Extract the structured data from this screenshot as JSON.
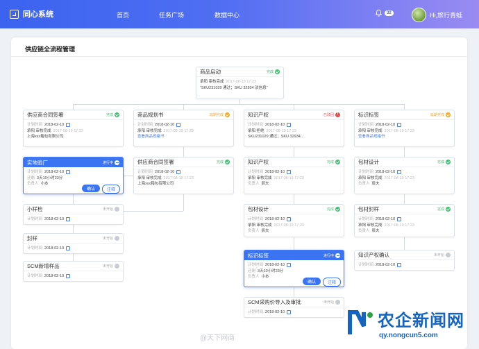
{
  "header": {
    "brand": "同心系统",
    "nav": [
      "首页",
      "任务广场",
      "数据中心"
    ],
    "notif_count": "32",
    "user": "Hi,旅行青蛙"
  },
  "panel": {
    "title": "供应链全流程管理"
  },
  "labels": {
    "plan": "计划时间",
    "owner": "负责人",
    "confirm": "确认",
    "note": "注释",
    "countdown": "还剩"
  },
  "cards": [
    {
      "id": "start",
      "title": "商品启动",
      "status": "完成",
      "type": "g",
      "rows": [
        {
          "a": "承阳",
          "b": "审核完成",
          "c": "2017-08-19 17:23"
        },
        {
          "t": "“SKU231029 通过；SKU 32934 驳信息”"
        }
      ]
    },
    {
      "id": "c1",
      "title": "供应商合同签署",
      "status": "完成",
      "type": "g",
      "rows": [
        {
          "plan": "2018-02-10"
        },
        {
          "a": "承阳",
          "b": "审核完成",
          "c": "2017-08-19 17:23"
        },
        {
          "t": "上海xxx箱包有限公司"
        }
      ]
    },
    {
      "id": "c2",
      "title": "商品规划书",
      "status": "延期完成",
      "type": "o",
      "rows": [
        {
          "plan": "2018-02-10"
        },
        {
          "a": "承阳",
          "b": "审核完成",
          "c": "2017-08-19 17:23"
        },
        {
          "link": "查看商品规格书"
        }
      ]
    },
    {
      "id": "c3",
      "title": "知识产权",
      "status": "已驳回",
      "type": "r",
      "rows": [
        {
          "plan": "2018-02-10"
        },
        {
          "a": "承阳",
          "b": "拒绝",
          "c": "2017-08-19 17:23"
        },
        {
          "t": "SKU231029 通过；SKU 32934..."
        }
      ]
    },
    {
      "id": "c4",
      "title": "标识标签",
      "status": "延期完成",
      "type": "o",
      "rows": [
        {
          "plan": "2018-02-10"
        },
        {
          "a": "承阳",
          "b": "审核完成",
          "c": "2017-08-19 17:23"
        },
        {
          "link": "查看商品规格书"
        }
      ]
    },
    {
      "id": "c5",
      "title": "实地验厂",
      "status": "进行中",
      "type": "w",
      "act": true,
      "rows": [
        {
          "plan": "2018-02-10"
        },
        {
          "remain": "3天10小时23分"
        },
        {
          "owner": "小本"
        }
      ]
    },
    {
      "id": "c6",
      "title": "供应商合同签署",
      "status": "完成",
      "type": "g",
      "rows": [
        {
          "plan": "2018-02-10"
        },
        {
          "a": "承阳",
          "b": "审核完成",
          "c": "2017-08-19 17:23"
        },
        {
          "t": "上海xxx箱包有限公司"
        }
      ]
    },
    {
      "id": "c7",
      "title": "知识产权",
      "status": "完成",
      "type": "g",
      "rows": [
        {
          "plan": "2018-02-10"
        },
        {
          "a": "承阳",
          "b": "审核完成",
          "c": "2017-08-19 17:23"
        },
        {
          "owner": "辰夫"
        }
      ]
    },
    {
      "id": "c8",
      "title": "包材设计",
      "status": "完成",
      "type": "g",
      "rows": [
        {
          "plan": "2018-02-10"
        },
        {
          "a": "承阳",
          "b": "审核完成",
          "c": "2017-08-19 17:23"
        },
        {
          "owner": "辰夫"
        }
      ]
    },
    {
      "id": "c9",
      "title": "小样检",
      "status": "未开始",
      "type": "gr",
      "rows": [
        {
          "plan": "2018-02-10"
        }
      ]
    },
    {
      "id": "c10",
      "title": "包材设计",
      "status": "完成",
      "type": "g",
      "rows": [
        {
          "plan": "2018-02-10"
        },
        {
          "a": "承阳",
          "b": "审核完成",
          "c": "2017-08-19 17:23"
        },
        {
          "owner": "辰夫"
        }
      ]
    },
    {
      "id": "c11",
      "title": "包材封样",
      "status": "完成",
      "type": "g",
      "rows": [
        {
          "plan": "2018-02-10"
        },
        {
          "a": "承阳",
          "b": "审核完成",
          "c": "2017-08-19 17:23"
        },
        {
          "owner": "辰夫"
        }
      ]
    },
    {
      "id": "c12",
      "title": "封样",
      "status": "未开始",
      "type": "gr",
      "rows": [
        {
          "plan": "2018-02-10"
        }
      ]
    },
    {
      "id": "c13",
      "title": "标识标签",
      "status": "进行中",
      "type": "w",
      "act": true,
      "rows": [
        {
          "plan": "2018-02-10"
        },
        {
          "remain": "3天10小时23分"
        },
        {
          "owner": "小本"
        }
      ]
    },
    {
      "id": "c14",
      "title": "知识产权确认",
      "status": "未开始",
      "type": "gr",
      "rows": [
        {
          "plan": "2018-02-10"
        }
      ]
    },
    {
      "id": "c15",
      "title": "SCM新增样品",
      "status": "未开始",
      "type": "gr",
      "rows": [
        {
          "plan": "2018-02-10"
        }
      ]
    },
    {
      "id": "c16",
      "title": "SCM采购价导入及审批",
      "status": "未开始",
      "type": "gr",
      "rows": [
        {
          "plan": "2018-02-10"
        }
      ]
    }
  ],
  "watermark": "@天下网商",
  "brandmark": {
    "name": "农企新闻网",
    "url": "qy.nongcun5.com"
  }
}
